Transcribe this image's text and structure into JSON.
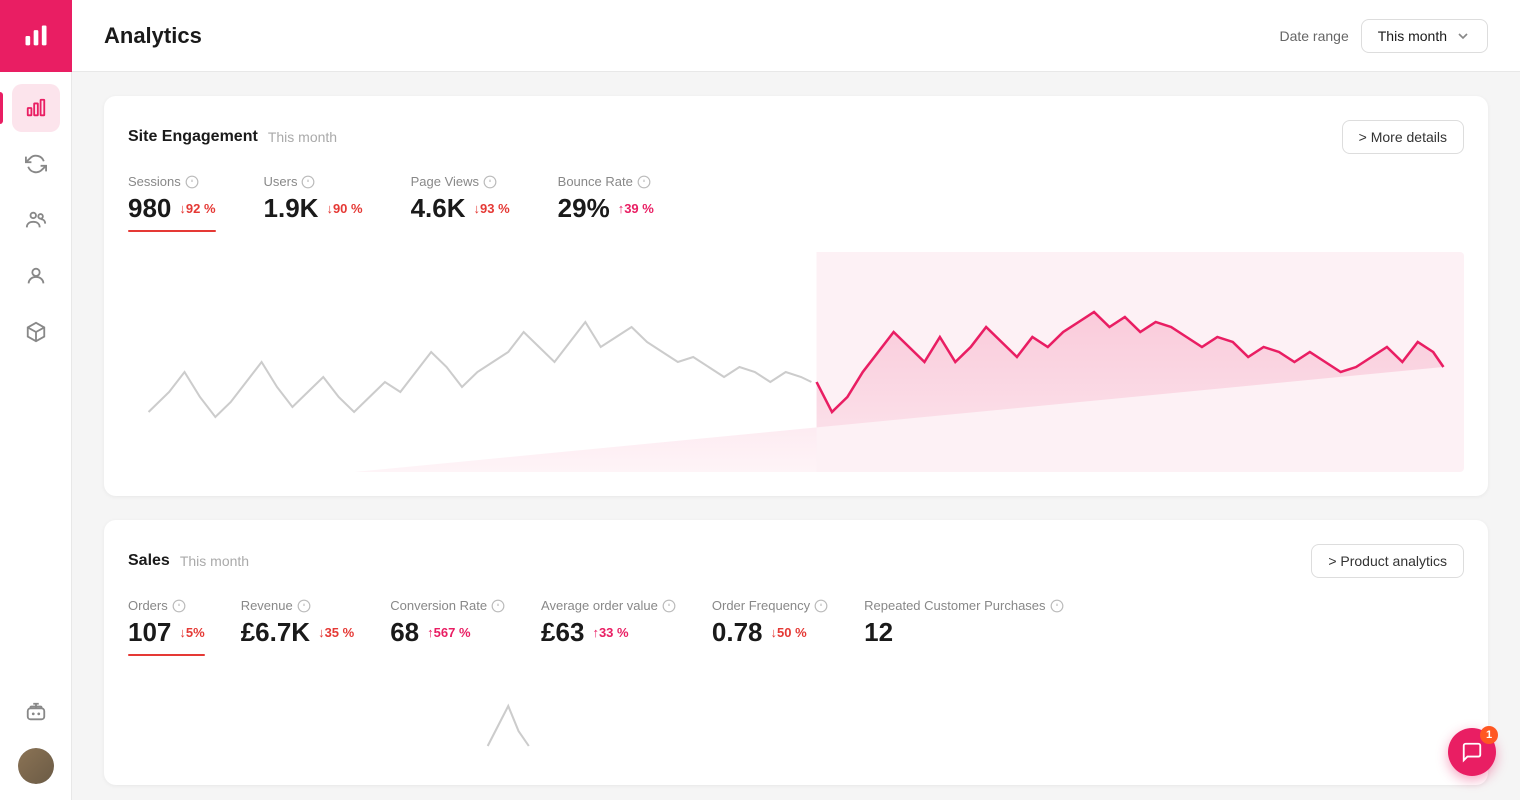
{
  "app": {
    "title": "Analytics",
    "logo_icon": "chart-icon"
  },
  "header": {
    "date_range_label": "Date range",
    "date_range_value": "This month"
  },
  "sidebar": {
    "items": [
      {
        "id": "analytics",
        "icon": "bar-chart-icon",
        "active": true
      },
      {
        "id": "refresh",
        "icon": "refresh-icon",
        "active": false
      },
      {
        "id": "audience",
        "icon": "audience-icon",
        "active": false
      },
      {
        "id": "user",
        "icon": "user-icon",
        "active": false
      },
      {
        "id": "cube",
        "icon": "cube-icon",
        "active": false
      },
      {
        "id": "bot",
        "icon": "bot-icon",
        "active": false
      }
    ]
  },
  "site_engagement": {
    "title": "Site Engagement",
    "subtitle": "This month",
    "more_details_label": "> More details",
    "metrics": [
      {
        "id": "sessions",
        "label": "Sessions",
        "value": "980",
        "change": "↓92 %",
        "direction": "down"
      },
      {
        "id": "users",
        "label": "Users",
        "value": "1.9K",
        "change": "↓90 %",
        "direction": "down"
      },
      {
        "id": "page_views",
        "label": "Page Views",
        "value": "4.6K",
        "change": "↓93 %",
        "direction": "down"
      },
      {
        "id": "bounce_rate",
        "label": "Bounce Rate",
        "value": "29%",
        "change": "↑39 %",
        "direction": "up"
      }
    ]
  },
  "sales": {
    "title": "Sales",
    "subtitle": "This month",
    "product_analytics_label": "> Product analytics",
    "metrics": [
      {
        "id": "orders",
        "label": "Orders",
        "value": "107",
        "change": "↓5%",
        "direction": "down"
      },
      {
        "id": "revenue",
        "label": "Revenue",
        "value": "£6.7K",
        "change": "↓35 %",
        "direction": "down"
      },
      {
        "id": "conversion_rate",
        "label": "Conversion Rate",
        "value": "68",
        "change": "↑567 %",
        "direction": "up"
      },
      {
        "id": "avg_order",
        "label": "Average order value",
        "value": "£63",
        "change": "↑33 %",
        "direction": "up"
      },
      {
        "id": "order_freq",
        "label": "Order Frequency",
        "value": "0.78",
        "change": "↓50 %",
        "direction": "down"
      },
      {
        "id": "repeat_purchases",
        "label": "Repeated Customer Purchases",
        "value": "12",
        "change": null,
        "direction": null
      }
    ]
  },
  "chat": {
    "badge_count": "1"
  }
}
